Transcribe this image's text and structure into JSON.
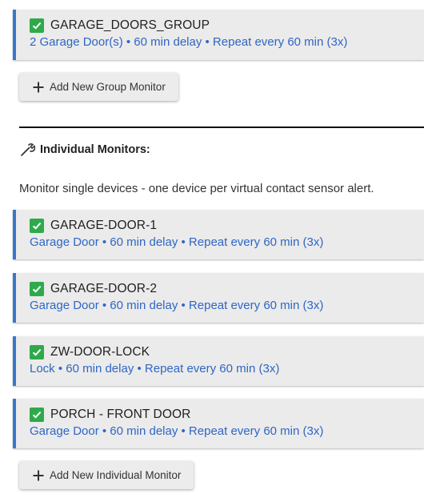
{
  "group_monitors": [
    {
      "name": "GARAGE_DOORS_GROUP",
      "summary": "2 Garage Door(s) • 60 min delay • Repeat every 60 min (3x)",
      "enabled": true
    }
  ],
  "add_group_button": {
    "label": "Add New Group Monitor",
    "icon": "plus-icon"
  },
  "individual_section": {
    "title": "Individual Monitors:",
    "icon": "wrench-icon",
    "description": "Monitor single devices - one device per virtual contact sensor alert."
  },
  "individual_monitors": [
    {
      "name": "GARAGE-DOOR-1",
      "summary": "Garage Door • 60 min delay • Repeat every 60 min (3x)",
      "enabled": true
    },
    {
      "name": "GARAGE-DOOR-2",
      "summary": "Garage Door • 60 min delay • Repeat every 60 min (3x)",
      "enabled": true
    },
    {
      "name": "ZW-DOOR-LOCK",
      "summary": "Lock • 60 min delay • Repeat every 60 min (3x)",
      "enabled": true
    },
    {
      "name": "PORCH - FRONT DOOR",
      "summary": "Garage Door • 60 min delay • Repeat every 60 min (3x)",
      "enabled": true
    }
  ],
  "add_individual_button": {
    "label": "Add New Individual Monitor",
    "icon": "plus-icon"
  },
  "colors": {
    "accent_border": "#3a78c9",
    "summary_text": "#2f66c4",
    "check_green": "#2eaa4a",
    "card_bg": "#ebebeb"
  }
}
